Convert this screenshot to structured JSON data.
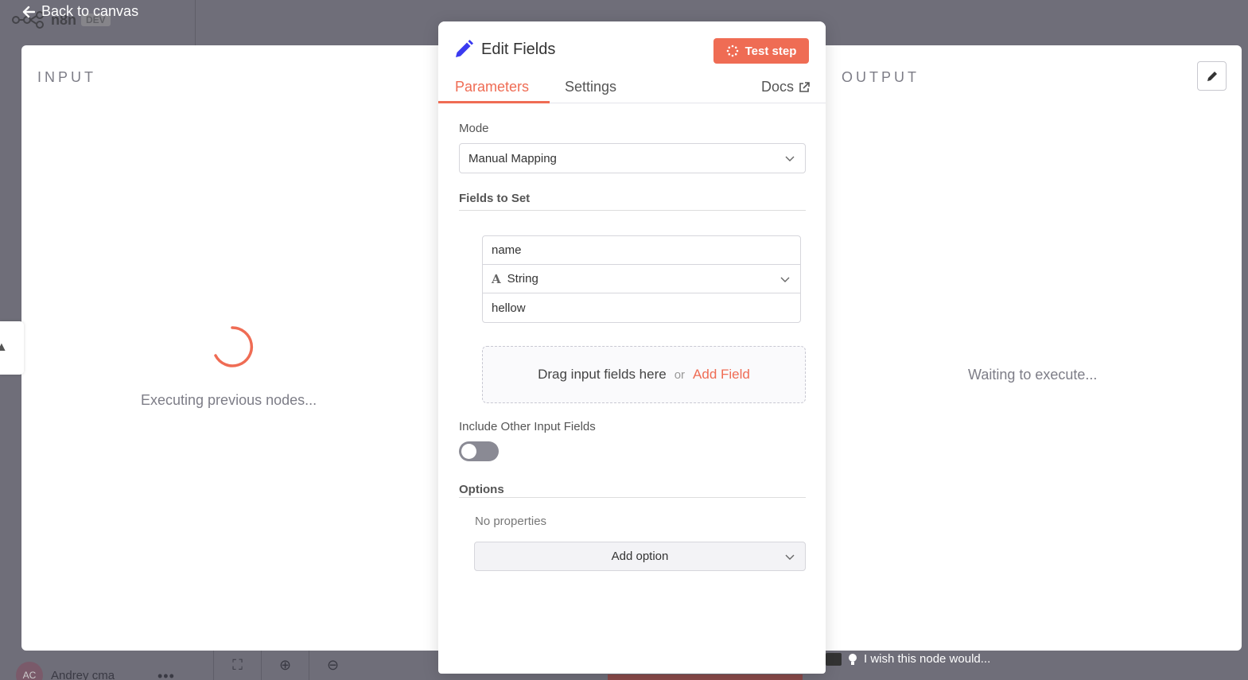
{
  "background": {
    "logo_text": "n8n",
    "logo_badge": "DEV",
    "user_initials": "AC",
    "user_name": "Andrey cma",
    "menu_dots": "•••"
  },
  "nav": {
    "back_label": "Back to canvas"
  },
  "input_panel": {
    "label": "INPUT",
    "status": "Executing previous nodes..."
  },
  "output_panel": {
    "label": "OUTPUT",
    "status": "Waiting to execute..."
  },
  "node": {
    "title": "Edit Fields",
    "test_button": "Test step",
    "accent_color": "#ef6c54",
    "tabs": {
      "parameters": "Parameters",
      "settings": "Settings",
      "docs": "Docs"
    },
    "mode": {
      "label": "Mode",
      "value": "Manual Mapping"
    },
    "fields_to_set": {
      "label": "Fields to Set",
      "assignment": {
        "name": "name",
        "type": "String",
        "value": "hellow"
      },
      "drop_hint": "Drag input fields here",
      "or": "or",
      "add_field": "Add Field"
    },
    "include_other": {
      "label": "Include Other Input Fields",
      "enabled": false
    },
    "options": {
      "label": "Options",
      "empty": "No properties",
      "add_option": "Add option"
    }
  },
  "feedback": {
    "text": "I wish this node would..."
  }
}
